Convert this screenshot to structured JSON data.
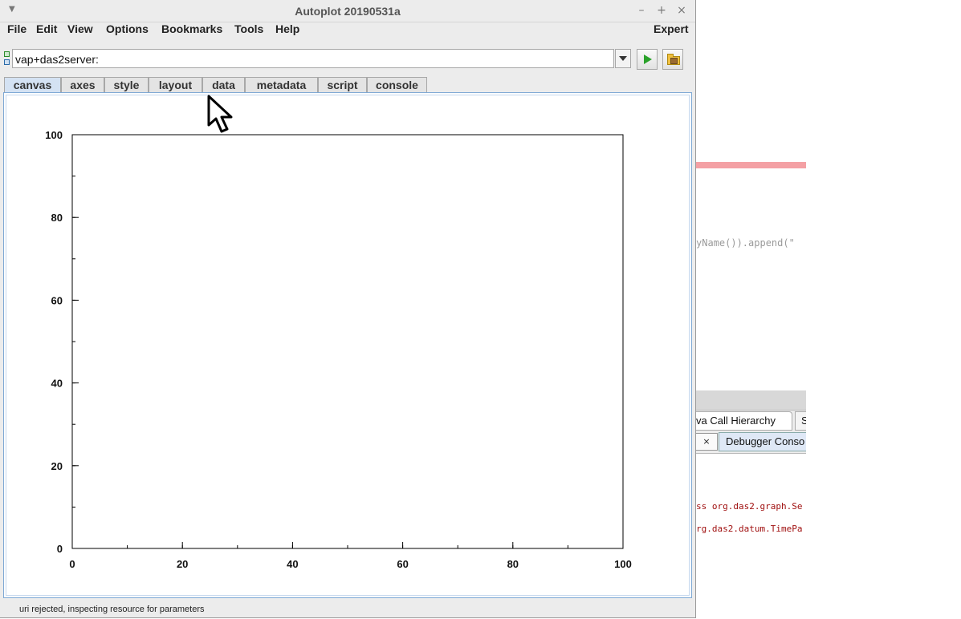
{
  "background_app": {
    "code_snippet": "yName()).append(\"",
    "tab_call_hierarchy": "va Call Hierarchy",
    "tab_s": "S",
    "close_label": "×",
    "debugger_tab": "Debugger Conso",
    "error_line_1": "ss org.das2.graph.Se",
    "error_line_2": "rg.das2.datum.TimePa"
  },
  "window": {
    "title": "Autoplot 20190531a",
    "minimize": "–",
    "maximize": "+",
    "close": "×"
  },
  "menu": {
    "file": "File",
    "edit": "Edit",
    "view": "View",
    "options": "Options",
    "bookmarks": "Bookmarks",
    "tools": "Tools",
    "help": "Help",
    "expert": "Expert"
  },
  "uri": {
    "value": "vap+das2server:"
  },
  "tabs": {
    "canvas": "canvas",
    "axes": "axes",
    "style": "style",
    "layout": "layout",
    "data": "data",
    "metadata": "metadata",
    "script": "script",
    "console": "console",
    "active": "canvas"
  },
  "chart_data": {
    "type": "line",
    "title": "",
    "xlabel": "",
    "ylabel": "",
    "x": [],
    "y": [],
    "xlim": [
      0,
      100
    ],
    "ylim": [
      0,
      100
    ],
    "xticks": [
      "0",
      "20",
      "40",
      "60",
      "80",
      "100"
    ],
    "yticks": [
      "0",
      "20",
      "40",
      "60",
      "80",
      "100"
    ],
    "xtick_values": [
      0,
      20,
      40,
      60,
      80,
      100
    ],
    "ytick_values": [
      0,
      20,
      40,
      60,
      80,
      100
    ],
    "minor_step": 10,
    "grid": false
  },
  "status": {
    "message": "uri rejected, inspecting resource for parameters"
  }
}
